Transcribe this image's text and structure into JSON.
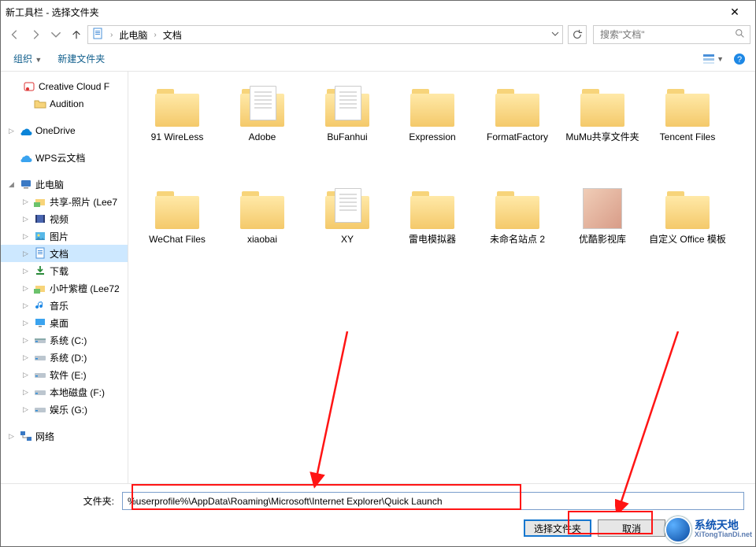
{
  "window": {
    "title": "新工具栏 - 选择文件夹"
  },
  "nav": {
    "breadcrumb": {
      "root": "此电脑",
      "current": "文档"
    },
    "search_placeholder": "搜索\"文档\""
  },
  "toolbar": {
    "organize": "组织",
    "new_folder": "新建文件夹"
  },
  "tree": {
    "creative_cloud": "Creative Cloud F",
    "audition": "Audition",
    "onedrive": "OneDrive",
    "wps": "WPS云文档",
    "this_pc": "此电脑",
    "share_photos": "共享-照片 (Lee7",
    "video": "视频",
    "pictures": "图片",
    "documents": "文档",
    "downloads": "下载",
    "xiaoye": "小叶紫檀 (Lee72",
    "music": "音乐",
    "desktop": "桌面",
    "drive_c": "系统 (C:)",
    "drive_d": "系统 (D:)",
    "drive_e": "软件 (E:)",
    "drive_f": "本地磁盘 (F:)",
    "drive_g": "娱乐 (G:)",
    "network": "网络"
  },
  "files": {
    "items": [
      {
        "name": "91 WireLess",
        "kind": "folder"
      },
      {
        "name": "Adobe",
        "kind": "folder-doc"
      },
      {
        "name": "BuFanhui",
        "kind": "folder-doc"
      },
      {
        "name": "Expression",
        "kind": "folder"
      },
      {
        "name": "FormatFactory",
        "kind": "folder"
      },
      {
        "name": "MuMu共享文件夹",
        "kind": "folder"
      },
      {
        "name": "Tencent Files",
        "kind": "folder"
      },
      {
        "name": "WeChat Files",
        "kind": "folder"
      },
      {
        "name": "xiaobai",
        "kind": "folder"
      },
      {
        "name": "XY",
        "kind": "folder-doc"
      },
      {
        "name": "雷电模拟器",
        "kind": "folder"
      },
      {
        "name": "未命名站点 2",
        "kind": "folder"
      },
      {
        "name": "优酷影视库",
        "kind": "thumb"
      },
      {
        "name": "自定义 Office 模板",
        "kind": "folder"
      }
    ]
  },
  "footer": {
    "label": "文件夹:",
    "value": "%userprofile%\\AppData\\Roaming\\Microsoft\\Internet Explorer\\Quick Launch",
    "select_btn": "选择文件夹",
    "cancel_btn": "取消"
  },
  "watermark": {
    "cn": "系统天地",
    "en": "XiTongTianDi.net"
  }
}
